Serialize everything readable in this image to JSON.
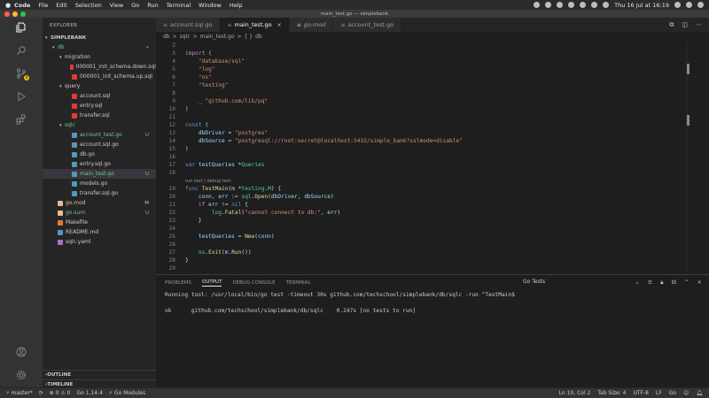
{
  "menubar": {
    "app": "Code",
    "items": [
      "File",
      "Edit",
      "Selection",
      "View",
      "Go",
      "Run",
      "Terminal",
      "Window",
      "Help"
    ],
    "clock": "Thu 16 Jul at 16:19"
  },
  "window": {
    "title": "main_test.go — simplebank",
    "colors": {
      "close": "#ff5f57",
      "minimize": "#febc2e",
      "zoom": "#28c840"
    }
  },
  "activitybar": {
    "icons": [
      "files-icon",
      "search-icon",
      "source-control-icon",
      "run-icon",
      "extensions-icon",
      "account-icon",
      "gear-icon"
    ],
    "scm_badge": "4"
  },
  "sidebar": {
    "header": "EXPLORER",
    "project": "SIMPLEBANK",
    "tree": [
      {
        "label": "db",
        "depth": 1,
        "type": "folder",
        "open": true,
        "badge": "•",
        "color": "#73c991"
      },
      {
        "label": "migration",
        "depth": 2,
        "type": "folder",
        "open": true
      },
      {
        "label": "000001_init_schema.down.sql",
        "depth": 3,
        "type": "sql"
      },
      {
        "label": "000001_init_schema.up.sql",
        "depth": 3,
        "type": "sql"
      },
      {
        "label": "query",
        "depth": 2,
        "type": "folder",
        "open": true
      },
      {
        "label": "account.sql",
        "depth": 3,
        "type": "sql"
      },
      {
        "label": "entry.sql",
        "depth": 3,
        "type": "sql"
      },
      {
        "label": "transfer.sql",
        "depth": 3,
        "type": "sql"
      },
      {
        "label": "sqlc",
        "depth": 2,
        "type": "folder",
        "open": true,
        "color": "#73c991"
      },
      {
        "label": "account_test.go",
        "depth": 3,
        "type": "go",
        "badge": "U",
        "color": "#73c991"
      },
      {
        "label": "account.sql.go",
        "depth": 3,
        "type": "go"
      },
      {
        "label": "db.go",
        "depth": 3,
        "type": "go"
      },
      {
        "label": "entry.sql.go",
        "depth": 3,
        "type": "go"
      },
      {
        "label": "main_test.go",
        "depth": 3,
        "type": "go",
        "badge": "U",
        "color": "#73c991",
        "selected": true
      },
      {
        "label": "models.go",
        "depth": 3,
        "type": "go"
      },
      {
        "label": "transfer.sql.go",
        "depth": 3,
        "type": "go"
      },
      {
        "label": "go.mod",
        "depth": 1,
        "type": "mod",
        "badge": "M",
        "color": "#e2c08d"
      },
      {
        "label": "go.sum",
        "depth": 1,
        "type": "mod",
        "badge": "U",
        "color": "#73c991"
      },
      {
        "label": "Makefile",
        "depth": 1,
        "type": "make"
      },
      {
        "label": "README.md",
        "depth": 1,
        "type": "md"
      },
      {
        "label": "sqlc.yaml",
        "depth": 1,
        "type": "yaml"
      }
    ],
    "outline": "OUTLINE",
    "timeline": "TIMELINE"
  },
  "tabs": [
    {
      "label": "account.sql.go",
      "active": false
    },
    {
      "label": "main_test.go",
      "active": true,
      "close": "×"
    },
    {
      "label": "go.mod",
      "active": false
    },
    {
      "label": "account_test.go",
      "active": false
    }
  ],
  "breadcrumb": [
    "db",
    ">",
    "sqlc",
    ">",
    "main_test.go",
    ">",
    "{ }",
    "db"
  ],
  "codelens": "run test | debug test",
  "code": [
    {
      "n": "2",
      "parts": []
    },
    {
      "n": "3",
      "parts": [
        [
          "k",
          "import"
        ],
        [
          "p",
          " ("
        ]
      ]
    },
    {
      "n": "4",
      "parts": [
        [
          "p",
          "    "
        ],
        [
          "s",
          "\"database/sql\""
        ]
      ]
    },
    {
      "n": "5",
      "parts": [
        [
          "p",
          "    "
        ],
        [
          "s",
          "\"log\""
        ]
      ]
    },
    {
      "n": "6",
      "parts": [
        [
          "p",
          "    "
        ],
        [
          "s",
          "\"os\""
        ]
      ]
    },
    {
      "n": "7",
      "parts": [
        [
          "p",
          "    "
        ],
        [
          "s",
          "\"testing\""
        ]
      ]
    },
    {
      "n": "8",
      "parts": []
    },
    {
      "n": "9",
      "parts": [
        [
          "p",
          "    _ "
        ],
        [
          "s",
          "\"github.com/lib/pq\""
        ]
      ]
    },
    {
      "n": "10",
      "parts": [
        [
          "p",
          ")"
        ]
      ]
    },
    {
      "n": "11",
      "parts": []
    },
    {
      "n": "12",
      "parts": [
        [
          "kw",
          "const"
        ],
        [
          "p",
          " ("
        ]
      ]
    },
    {
      "n": "13",
      "parts": [
        [
          "p",
          "    "
        ],
        [
          "v",
          "dbDriver"
        ],
        [
          "p",
          " = "
        ],
        [
          "s",
          "\"postgres\""
        ]
      ]
    },
    {
      "n": "14",
      "parts": [
        [
          "p",
          "    "
        ],
        [
          "v",
          "dbSource"
        ],
        [
          "p",
          " = "
        ],
        [
          "s",
          "\"postgresql://root:secret@localhost:5432/simple_bank?sslmode=disable\""
        ]
      ]
    },
    {
      "n": "15",
      "parts": [
        [
          "p",
          ")"
        ]
      ]
    },
    {
      "n": "16",
      "parts": []
    },
    {
      "n": "17",
      "parts": [
        [
          "kw",
          "var"
        ],
        [
          "p",
          " "
        ],
        [
          "v",
          "testQueries"
        ],
        [
          "p",
          " *"
        ],
        [
          "t",
          "Queries"
        ]
      ]
    },
    {
      "n": "18",
      "parts": []
    },
    {
      "lens": true
    },
    {
      "n": "19",
      "parts": [
        [
          "kw",
          "func"
        ],
        [
          "p",
          " "
        ],
        [
          "f",
          "TestMain"
        ],
        [
          "p",
          "("
        ],
        [
          "v",
          "m"
        ],
        [
          "p",
          " *"
        ],
        [
          "t",
          "testing"
        ],
        [
          "p",
          "."
        ],
        [
          "t",
          "M"
        ],
        [
          "p",
          ") {"
        ]
      ]
    },
    {
      "n": "20",
      "parts": [
        [
          "p",
          "    "
        ],
        [
          "v",
          "conn"
        ],
        [
          "p",
          ", "
        ],
        [
          "v",
          "err"
        ],
        [
          "p",
          " := "
        ],
        [
          "t",
          "sql"
        ],
        [
          "p",
          "."
        ],
        [
          "f",
          "Open"
        ],
        [
          "p",
          "("
        ],
        [
          "v",
          "dbDriver"
        ],
        [
          "p",
          ", "
        ],
        [
          "v",
          "dbSource"
        ],
        [
          "p",
          ")"
        ]
      ]
    },
    {
      "n": "21",
      "parts": [
        [
          "p",
          "    "
        ],
        [
          "k",
          "if"
        ],
        [
          "p",
          " "
        ],
        [
          "v",
          "err"
        ],
        [
          "p",
          " != "
        ],
        [
          "c1",
          "nil"
        ],
        [
          "p",
          " {"
        ]
      ]
    },
    {
      "n": "22",
      "parts": [
        [
          "p",
          "        "
        ],
        [
          "t",
          "log"
        ],
        [
          "p",
          "."
        ],
        [
          "f",
          "Fatal"
        ],
        [
          "p",
          "("
        ],
        [
          "s",
          "\"cannot connect to db:\""
        ],
        [
          "p",
          ", "
        ],
        [
          "v",
          "err"
        ],
        [
          "p",
          ")"
        ]
      ]
    },
    {
      "n": "23",
      "parts": [
        [
          "p",
          "    }"
        ]
      ]
    },
    {
      "n": "24",
      "parts": []
    },
    {
      "n": "25",
      "parts": [
        [
          "p",
          "    "
        ],
        [
          "v",
          "testQueries"
        ],
        [
          "p",
          " = "
        ],
        [
          "f",
          "New"
        ],
        [
          "p",
          "("
        ],
        [
          "v",
          "conn"
        ],
        [
          "p",
          ")"
        ]
      ]
    },
    {
      "n": "26",
      "parts": []
    },
    {
      "n": "27",
      "parts": [
        [
          "p",
          "    "
        ],
        [
          "t",
          "os"
        ],
        [
          "p",
          "."
        ],
        [
          "f",
          "Exit"
        ],
        [
          "p",
          "("
        ],
        [
          "v",
          "m"
        ],
        [
          "p",
          "."
        ],
        [
          "f",
          "Run"
        ],
        [
          "p",
          "())"
        ]
      ]
    },
    {
      "n": "28",
      "parts": [
        [
          "p",
          "}"
        ]
      ]
    },
    {
      "n": "29",
      "parts": []
    }
  ],
  "panel": {
    "tabs": [
      "PROBLEMS",
      "OUTPUT",
      "DEBUG CONSOLE",
      "TERMINAL"
    ],
    "active_tab": "OUTPUT",
    "channel": "Go Tests",
    "lines": [
      "Running tool: /usr/local/bin/go test -timeout 30s github.com/techschool/simplebank/db/sqlc -run ^TestMain$",
      "",
      "ok      github.com/techschool/simplebank/db/sqlc    0.247s [no tests to run]"
    ]
  },
  "statusbar": {
    "branch": "master*",
    "sync": "⟳",
    "problems": "⊗ 0 ⚠ 0",
    "go_version": "Go 1.14.4",
    "go_modules": "Go Modules",
    "position": "Ln 10, Col 2",
    "tab_size": "Tab Size: 4",
    "encoding": "UTF-8",
    "eol": "LF",
    "language": "Go"
  }
}
